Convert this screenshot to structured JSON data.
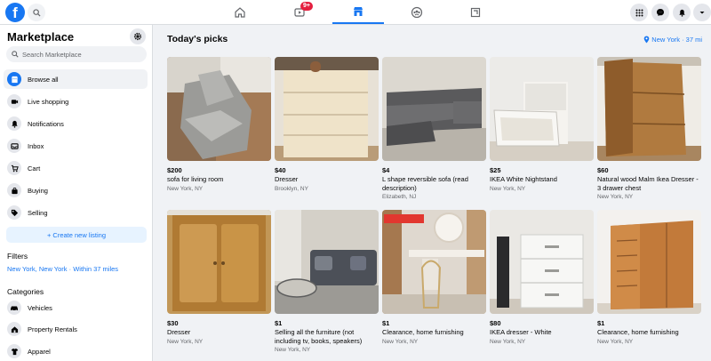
{
  "topbar": {
    "notification_badge": "9+"
  },
  "sidebar": {
    "title": "Marketplace",
    "search_placeholder": "Search Marketplace",
    "items": [
      {
        "label": "Browse all",
        "icon": "storefront-icon",
        "active": true
      },
      {
        "label": "Live shopping",
        "icon": "live-video-icon"
      },
      {
        "label": "Notifications",
        "icon": "bell-icon"
      },
      {
        "label": "Inbox",
        "icon": "inbox-icon"
      },
      {
        "label": "Cart",
        "icon": "cart-icon"
      },
      {
        "label": "Buying",
        "icon": "shopping-bag-icon"
      },
      {
        "label": "Selling",
        "icon": "tag-icon"
      }
    ],
    "create_listing": "+ Create new listing",
    "filters_heading": "Filters",
    "filter_location": "New York, New York · Within 37 miles",
    "categories_heading": "Categories",
    "categories": [
      {
        "label": "Vehicles",
        "icon": "car-icon"
      },
      {
        "label": "Property Rentals",
        "icon": "house-icon"
      },
      {
        "label": "Apparel",
        "icon": "shirt-icon"
      }
    ]
  },
  "main": {
    "title": "Today's picks",
    "location": "New York · 37 mi",
    "listings": [
      {
        "price": "$200",
        "title": "sofa for living room",
        "location": "New York, NY"
      },
      {
        "price": "$40",
        "title": "Dresser",
        "location": "Brooklyn, NY"
      },
      {
        "price": "$4",
        "title": "L shape reversible sofa (read description)",
        "location": "Elizabeth, NJ"
      },
      {
        "price": "$25",
        "title": "IKEA White Nightstand",
        "location": "New York, NY"
      },
      {
        "price": "$60",
        "title": "Natural wood Malm Ikea Dresser - 3 drawer chest",
        "location": "New York, NY"
      },
      {
        "price": "$30",
        "title": "Dresser",
        "location": "New York, NY"
      },
      {
        "price": "$1",
        "title": "Selling all the furniture (not including tv, books, speakers)",
        "location": "New York, NY"
      },
      {
        "price": "$1",
        "title": "Clearance, home furnishing",
        "location": "New York, NY"
      },
      {
        "price": "$80",
        "title": "IKEA dresser - White",
        "location": "New York, NY"
      },
      {
        "price": "$1",
        "title": "Clearance, home furnishing",
        "location": "New York, NY"
      }
    ]
  },
  "colors": {
    "accent": "#1877f2",
    "badge": "#e41e3f",
    "background": "#f0f2f5"
  }
}
